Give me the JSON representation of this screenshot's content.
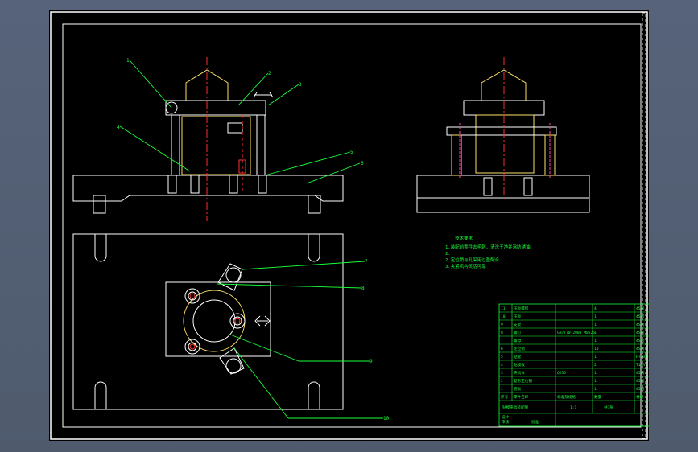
{
  "app": {
    "name": "CAD drawing viewer"
  },
  "colors": {
    "background": "#000000",
    "frame": "#ffffff",
    "contour": "#ffffff",
    "centerline": "#ff2b2b",
    "hidden": "#ff3fb0",
    "part": "#ffe066",
    "leader": "#1bff3a",
    "table_border": "#1bff3a",
    "table_text": "#1bff3a"
  },
  "balloons": [
    "1",
    "2",
    "3",
    "4",
    "5",
    "6",
    "7",
    "8",
    "9",
    "10"
  ],
  "notes": {
    "heading": "技术要求",
    "lines": [
      "1.装配前零件去毛刺，清洗干净并涂防锈油",
      "2.",
      "2.定位销与孔采用过盈配合",
      "3.夹紧机构灵活可靠"
    ]
  },
  "parts_table": {
    "rows": [
      {
        "no": "11",
        "name": "压板螺钉",
        "std": "",
        "qty": "4",
        "mat": "45钢"
      },
      {
        "no": "10",
        "name": "压板",
        "std": "",
        "qty": "1",
        "mat": "45钢"
      },
      {
        "no": "9",
        "name": "支架",
        "std": "",
        "qty": "1",
        "mat": "45钢"
      },
      {
        "no": "8",
        "name": "螺钉",
        "std": "GB/T70-2000 M8x25",
        "qty": "1",
        "mat": "45钢"
      },
      {
        "no": "7",
        "name": "螺母",
        "std": "",
        "qty": "1",
        "mat": "45钢"
      },
      {
        "no": "6",
        "name": "定位销",
        "std": "",
        "qty": "10",
        "mat": "45钢"
      },
      {
        "no": "5",
        "name": "钻套",
        "std": "",
        "qty": "1",
        "mat": "HT200"
      },
      {
        "no": "4",
        "name": "钻模板",
        "std": "",
        "qty": "2",
        "mat": "T10A"
      },
      {
        "no": "3",
        "name": "夹具体",
        "std": "Q235",
        "qty": "1",
        "mat": "45钢"
      },
      {
        "no": "2",
        "name": "菱形定位销",
        "std": "",
        "qty": "1",
        "mat": "45钢"
      },
      {
        "no": "1",
        "name": "底板",
        "std": "",
        "qty": "1",
        "mat": "45钢"
      }
    ],
    "header": {
      "no": "序号",
      "name": "零件名称",
      "std": "标准及规格",
      "qty": "数量",
      "mat": "材料"
    },
    "title": "钻模夹具装配图",
    "scale": "1:1",
    "sheet": "共1张",
    "drawing_no": "JZ",
    "designer": "设计",
    "checker": "审核",
    "approver": "批准"
  }
}
